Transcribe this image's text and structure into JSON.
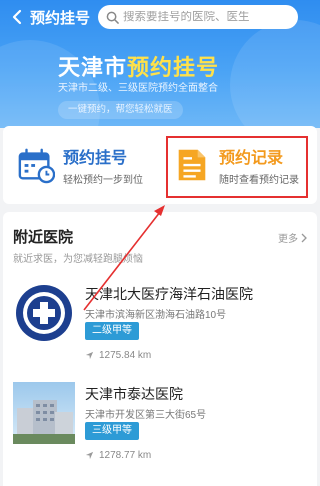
{
  "nav": {
    "title": "预约挂号",
    "search_placeholder": "搜索要挂号的医院、医生"
  },
  "banner": {
    "title_prefix": "天津市",
    "title_highlight": "预约挂号",
    "subtitle": "天津市二级、三级医院预约全面整合",
    "pill": "一键预约，帮您轻松就医"
  },
  "services": [
    {
      "label": "预约挂号",
      "desc": "轻松预约一步到位",
      "icon": "calendar-icon"
    },
    {
      "label": "预约记录",
      "desc": "随时查看预约记录",
      "icon": "document-icon"
    }
  ],
  "nearby": {
    "title": "附近医院",
    "subtitle": "就近求医，为您减轻跑腿烦恼",
    "more_label": "更多",
    "hospitals": [
      {
        "name": "天津北大医疗海洋石油医院",
        "address": "天津市滨海新区渤海石油路10号",
        "level": "二级甲等",
        "distance": "1275.84 km"
      },
      {
        "name": "天津市泰达医院",
        "address": "天津市开发区第三大街65号",
        "level": "三级甲等",
        "distance": "1278.77 km"
      }
    ]
  },
  "colors": {
    "header_blue": "#2f8df0",
    "highlight_yellow": "#ffe14a",
    "service_blue": "#2a6fc9",
    "service_orange": "#f39a1e",
    "annotation_red": "#e53030",
    "level_badge": "#2d9bd6"
  }
}
